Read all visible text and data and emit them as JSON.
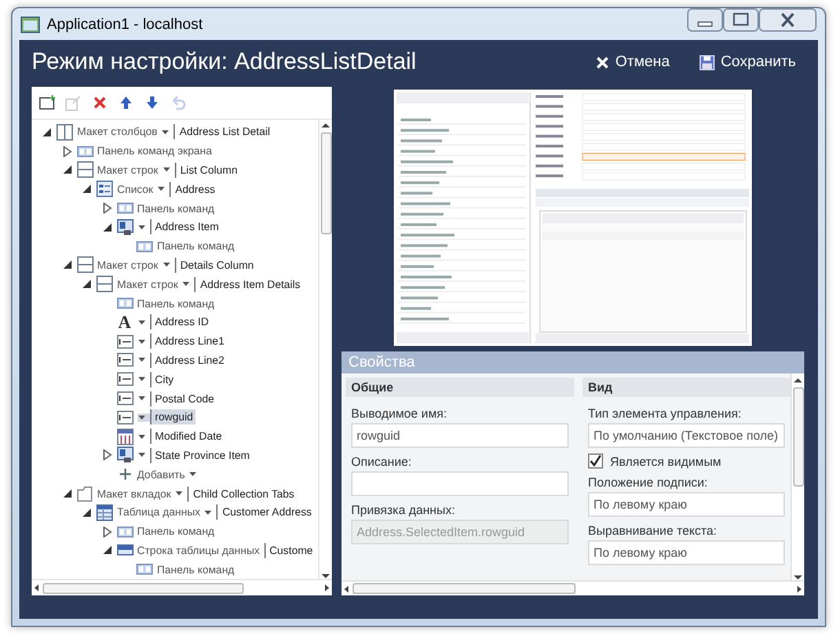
{
  "window": {
    "title": "Application1 - localhost"
  },
  "header": {
    "title": "Режим настройки: AddressListDetail",
    "buttons": [
      {
        "kind": "cancel",
        "label": "Отмена"
      },
      {
        "kind": "save",
        "label": "Сохранить"
      }
    ]
  },
  "toolbar": [
    {
      "kind": "add",
      "disabled": false
    },
    {
      "kind": "moveout",
      "disabled": true
    },
    {
      "kind": "delete",
      "disabled": false
    },
    {
      "kind": "up",
      "disabled": false
    },
    {
      "kind": "down",
      "disabled": false
    },
    {
      "kind": "undo",
      "disabled": true
    }
  ],
  "tree": [
    {
      "kind": "columns",
      "type": "Макет столбцов",
      "dropdown": true,
      "name": "Address List Detail",
      "expanded": true,
      "selected": false,
      "children": [
        {
          "kind": "command",
          "type": "Панель команд экрана",
          "dropdown": false,
          "expanded": false,
          "selected": false
        },
        {
          "kind": "rows",
          "type": "Макет строк",
          "dropdown": true,
          "name": "List Column",
          "expanded": true,
          "selected": false,
          "children": [
            {
              "kind": "list",
              "type": "Список",
              "dropdown": true,
              "name": "Address",
              "expanded": true,
              "selected": false,
              "children": [
                {
                  "kind": "command",
                  "type": "Панель команд",
                  "dropdown": false,
                  "expanded": false,
                  "selected": false
                },
                {
                  "kind": "item",
                  "dropdown": true,
                  "name": "Address Item",
                  "expanded": true,
                  "selected": false,
                  "children": [
                    {
                      "kind": "command",
                      "type": "Панель команд",
                      "dropdown": false,
                      "selected": false
                    }
                  ]
                }
              ]
            }
          ]
        },
        {
          "kind": "rows",
          "type": "Макет строк",
          "dropdown": true,
          "name": "Details Column",
          "expanded": true,
          "selected": false,
          "children": [
            {
              "kind": "rows",
              "type": "Макет строк",
              "dropdown": true,
              "name": "Address Item Details",
              "expanded": true,
              "selected": false,
              "children": [
                {
                  "kind": "command",
                  "type": "Панель команд",
                  "dropdown": false,
                  "selected": false
                },
                {
                  "kind": "label",
                  "glyph": "A",
                  "dropdown": true,
                  "name": "Address ID",
                  "selected": false
                },
                {
                  "kind": "textbox",
                  "dropdown": true,
                  "name": "Address Line1",
                  "selected": false
                },
                {
                  "kind": "textbox",
                  "dropdown": true,
                  "name": "Address Line2",
                  "selected": false
                },
                {
                  "kind": "textbox",
                  "dropdown": true,
                  "name": "City",
                  "selected": false
                },
                {
                  "kind": "textbox",
                  "dropdown": true,
                  "name": "Postal Code",
                  "selected": false
                },
                {
                  "kind": "textbox",
                  "dropdown": true,
                  "name": "rowguid",
                  "selected": true
                },
                {
                  "kind": "date",
                  "dropdown": true,
                  "name": "Modified Date",
                  "selected": false
                },
                {
                  "kind": "item",
                  "dropdown": true,
                  "name": "State Province Item",
                  "expanded": false,
                  "selected": false
                },
                {
                  "kind": "add",
                  "type": "Добавить",
                  "dropdown": true,
                  "selected": false
                }
              ]
            }
          ]
        },
        {
          "kind": "tabs",
          "type": "Макет вкладок",
          "dropdown": true,
          "name": "Child Collection Tabs",
          "expanded": true,
          "selected": false,
          "children": [
            {
              "kind": "grid",
              "type": "Таблица данных",
              "dropdown": true,
              "name": "Customer Address",
              "expanded": true,
              "selected": false,
              "children": [
                {
                  "kind": "command",
                  "type": "Панель команд",
                  "dropdown": false,
                  "expanded": false,
                  "selected": false
                },
                {
                  "kind": "gridrow",
                  "type": "Строка таблицы данных",
                  "dropdown": false,
                  "name": "Custome",
                  "expanded": true,
                  "selected": false,
                  "children": [
                    {
                      "kind": "command",
                      "type": "Панель команд",
                      "dropdown": false,
                      "selected": false
                    }
                  ]
                }
              ]
            }
          ]
        }
      ]
    }
  ],
  "properties": {
    "title": "Свойства",
    "sections": [
      {
        "title": "Общие",
        "items": [
          {
            "kind": "field",
            "label": "Выводимое имя:",
            "value": "rowguid",
            "disabled": false
          },
          {
            "kind": "field",
            "label": "Описание:",
            "disabled": false
          },
          {
            "kind": "field",
            "label": "Привязка данных:",
            "value": "Address.SelectedItem.rowguid",
            "disabled": true
          }
        ]
      },
      {
        "title": "Вид",
        "items": [
          {
            "kind": "field",
            "label": "Тип элемента управления:",
            "value": "По умолчанию (Текстовое поле)",
            "disabled": false
          },
          {
            "kind": "checkbox",
            "label": "Является видимым",
            "checked": true
          },
          {
            "kind": "field",
            "label": "Положение подписи:",
            "value": "По левому краю",
            "disabled": false
          },
          {
            "kind": "field",
            "label": "Выравнивание текста:",
            "value": "По левому краю",
            "disabled": false
          }
        ]
      }
    ]
  }
}
